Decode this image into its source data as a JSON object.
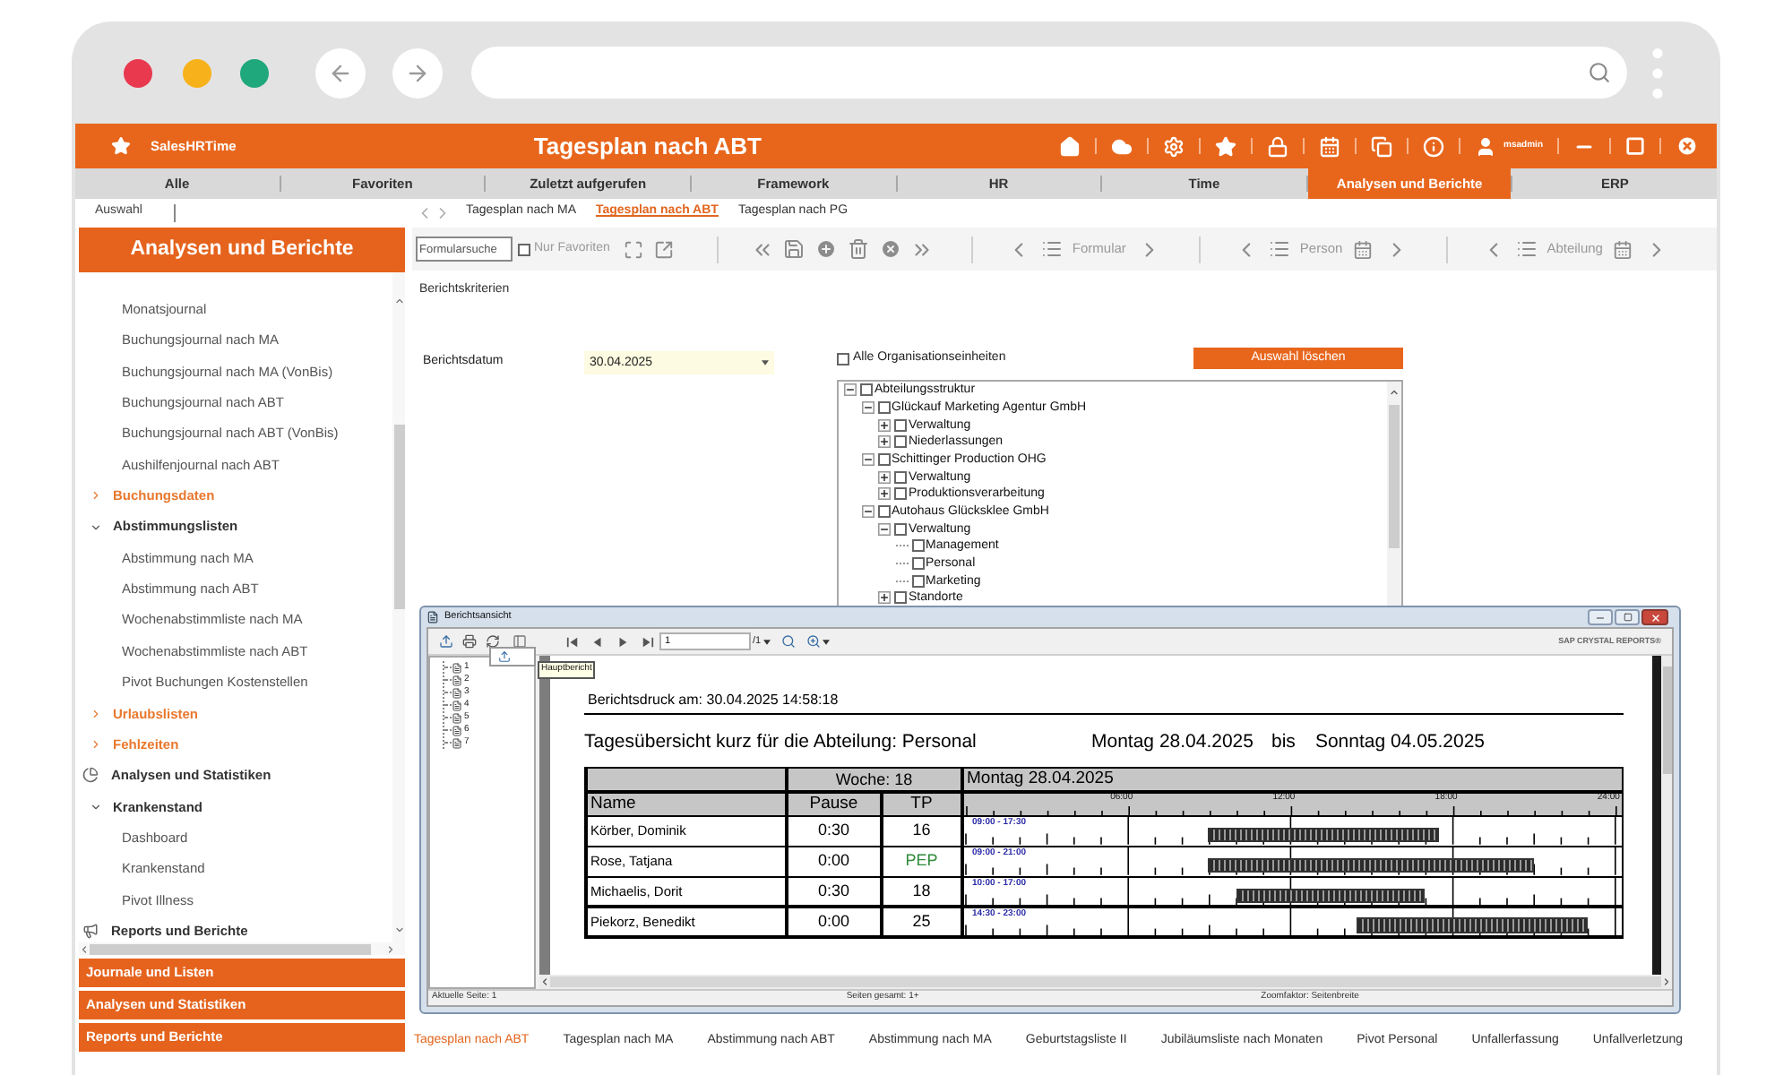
{
  "header": {
    "logo": "SalesHRTime",
    "title": "Tagesplan nach ABT",
    "user": "msadmin"
  },
  "tabs": [
    {
      "label": "Alle",
      "selected": false
    },
    {
      "label": "Favoriten",
      "selected": false
    },
    {
      "label": "Zuletzt aufgerufen",
      "selected": false
    },
    {
      "label": "Framework",
      "selected": false
    },
    {
      "label": "HR",
      "selected": false
    },
    {
      "label": "Time",
      "selected": false
    },
    {
      "label": "Analysen und Berichte",
      "selected": true
    },
    {
      "label": "ERP",
      "selected": false
    }
  ],
  "sidebar": {
    "picker": "Auswahl",
    "title": "Analysen und Berichte",
    "tree": [
      {
        "kind": "leaf",
        "label": "Monatsjournal"
      },
      {
        "kind": "leaf",
        "label": "Buchungsjournal nach MA"
      },
      {
        "kind": "leaf",
        "label": "Buchungsjournal nach MA (VonBis)"
      },
      {
        "kind": "leaf",
        "label": "Buchungsjournal nach ABT"
      },
      {
        "kind": "leaf",
        "label": "Buchungsjournal nach ABT (VonBis)"
      },
      {
        "kind": "leaf",
        "label": "Aushilfenjournal nach ABT"
      },
      {
        "kind": "group",
        "label": "Buchungsdaten",
        "expanded": false
      },
      {
        "kind": "group",
        "label": "Abstimmungslisten",
        "expanded": true,
        "children": [
          {
            "kind": "leaf",
            "label": "Abstimmung nach MA"
          },
          {
            "kind": "leaf",
            "label": "Abstimmung nach ABT"
          },
          {
            "kind": "leaf",
            "label": "Wochenabstimmliste nach MA"
          },
          {
            "kind": "leaf",
            "label": "Wochenabstimmliste nach ABT"
          },
          {
            "kind": "leaf",
            "label": "Pivot Buchungen Kostenstellen"
          }
        ]
      },
      {
        "kind": "group",
        "label": "Urlaubslisten",
        "expanded": false
      },
      {
        "kind": "group",
        "label": "Fehlzeiten",
        "expanded": false
      },
      {
        "kind": "section",
        "label": "Analysen und Statistiken",
        "children": [
          {
            "kind": "group",
            "label": "Krankenstand",
            "expanded": true,
            "children": [
              {
                "kind": "leaf",
                "label": "Dashboard"
              },
              {
                "kind": "leaf",
                "label": "Krankenstand"
              },
              {
                "kind": "leaf",
                "label": "Pivot Illness"
              }
            ]
          }
        ]
      },
      {
        "kind": "section",
        "label": "Reports und Berichte"
      }
    ],
    "sections": [
      "Journale und Listen",
      "Analysen und Statistiken",
      "Reports und Berichte"
    ]
  },
  "breadcrumbs": [
    {
      "label": "Tagesplan nach MA",
      "selected": false
    },
    {
      "label": "Tagesplan nach ABT",
      "selected": true
    },
    {
      "label": "Tagesplan nach PG",
      "selected": false
    }
  ],
  "toolbar": {
    "search": {
      "placeholder": "Formularsuche"
    },
    "favorites": {
      "label": "Nur Favoriten",
      "checked": false
    },
    "navigators": [
      {
        "label": "Formular",
        "kind": "plain"
      },
      {
        "label": "Person",
        "kind": "calendar"
      },
      {
        "label": "Abteilung",
        "kind": "calendar"
      }
    ]
  },
  "criteria": {
    "heading": "Berichtskriterien",
    "date": {
      "label": "Berichtsdatum",
      "value": "30.04.2025"
    },
    "all_units": {
      "label": "Alle Organisationseinheiten",
      "checked": false
    },
    "clear_button": "Auswahl löschen",
    "org_tree": [
      {
        "label": "Abteilungsstruktur",
        "checked": false,
        "expanded": true,
        "children": [
          {
            "label": "Glückauf Marketing Agentur GmbH",
            "checked": false,
            "expanded": true,
            "children": [
              {
                "label": "Verwaltung",
                "checked": false,
                "expanded": false
              },
              {
                "label": "Niederlassungen",
                "checked": false,
                "expanded": false
              }
            ]
          },
          {
            "label": "Schittinger Production OHG",
            "checked": false,
            "expanded": true,
            "children": [
              {
                "label": "Verwaltung",
                "checked": false,
                "expanded": false
              },
              {
                "label": "Produktionsverarbeitung",
                "checked": false,
                "expanded": false
              }
            ]
          },
          {
            "label": "Autohaus Glücksklee GmbH",
            "checked": false,
            "expanded": true,
            "children": [
              {
                "label": "Verwaltung",
                "checked": false,
                "expanded": true,
                "children": [
                  {
                    "label": "Management",
                    "checked": false
                  },
                  {
                    "label": "Personal",
                    "checked": false
                  },
                  {
                    "label": "Marketing",
                    "checked": false
                  }
                ]
              },
              {
                "label": "Standorte",
                "checked": false,
                "expanded": false
              }
            ]
          }
        ]
      }
    ]
  },
  "report": {
    "title": "Berichtsansicht",
    "page_field": "1",
    "page_total": "/1",
    "brand": "SAP CRYSTAL REPORTS®",
    "tooltip": "Hauptbericht",
    "pages": [
      "1",
      "2",
      "3",
      "4",
      "5",
      "6",
      "7"
    ],
    "printed": "Berichtsdruck am: 30.04.2025 14:58:18",
    "heading": "Tagesübersicht kurz für die Abteilung: Personal",
    "range": {
      "from": "Montag 28.04.2025",
      "separator": "bis",
      "to": "Sonntag 04.05.2025"
    },
    "table": {
      "week": "Woche: 18",
      "day": "Montag 28.04.2025",
      "columns": [
        "Name",
        "Pause",
        "TP"
      ],
      "scale": [
        "06:00",
        "12:00",
        "18:00",
        "24:00"
      ],
      "rows": [
        {
          "name": "Körber, Dominik",
          "pause": "0:30",
          "tp": {
            "text": "16",
            "kind": "number"
          },
          "shift": "09:00 - 17:30"
        },
        {
          "name": "Rose, Tatjana",
          "pause": "0:00",
          "tp": {
            "text": "PEP",
            "kind": "code"
          },
          "shift": "09:00 - 21:00"
        },
        {
          "name": "Michaelis, Dorit",
          "pause": "0:30",
          "tp": {
            "text": "18",
            "kind": "number"
          },
          "shift": "10:00 - 17:00"
        },
        {
          "name": "Piekorz, Benedikt",
          "pause": "0:00",
          "tp": {
            "text": "25",
            "kind": "number"
          },
          "shift": "14:30 - 23:00"
        }
      ]
    },
    "status": [
      "Aktuelle Seite: 1",
      "Seiten gesamt: 1+",
      "Zoomfaktor: Seitenbreite"
    ]
  },
  "bottom_tabs": [
    {
      "label": "Tagesplan nach ABT",
      "selected": true
    },
    {
      "label": "Tagesplan nach MA",
      "selected": false
    },
    {
      "label": "Abstimmung nach ABT",
      "selected": false
    },
    {
      "label": "Abstimmung nach MA",
      "selected": false
    },
    {
      "label": "Geburtstagsliste II",
      "selected": false
    },
    {
      "label": "Jubiläumsliste nach Monaten",
      "selected": false
    },
    {
      "label": "Pivot Personal",
      "selected": false
    },
    {
      "label": "Unfallerfassung",
      "selected": false
    },
    {
      "label": "Unfallverletzung",
      "selected": false
    }
  ]
}
